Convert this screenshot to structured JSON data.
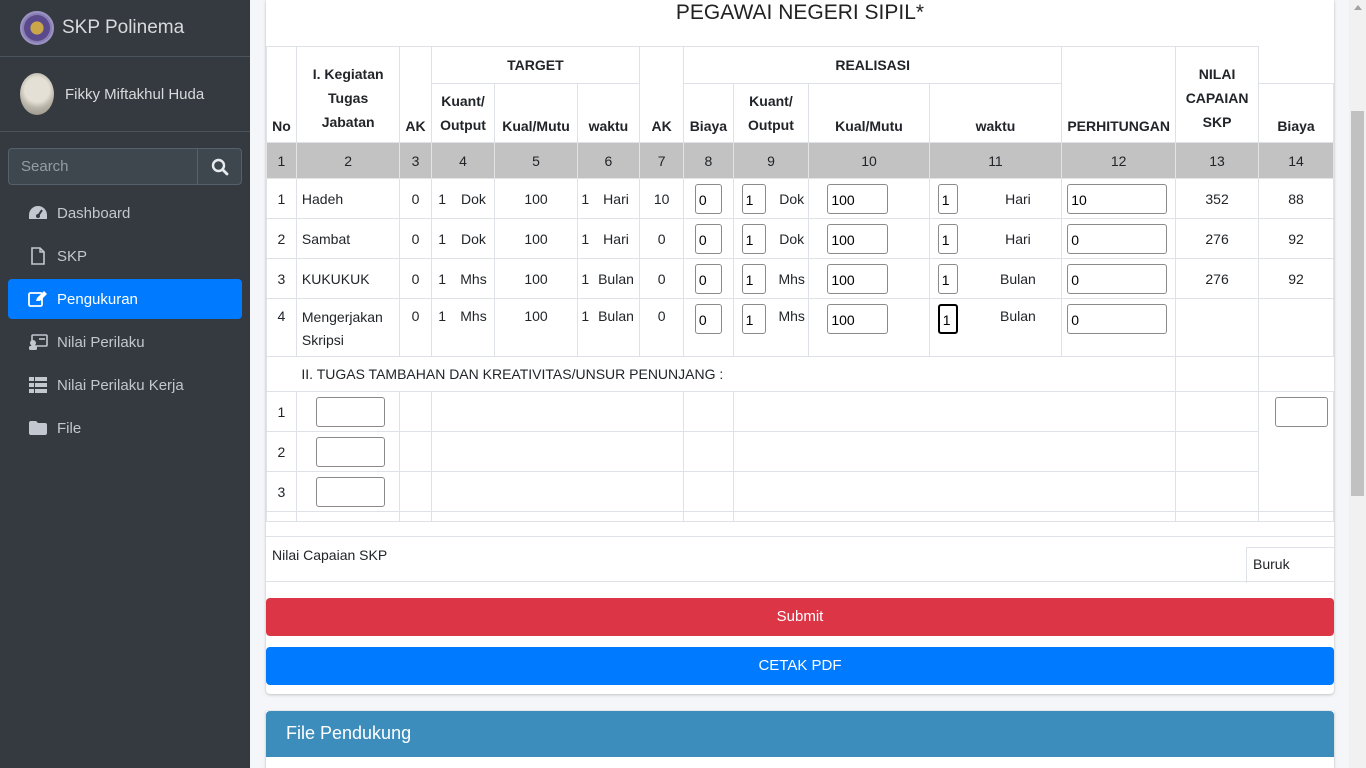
{
  "app": {
    "brand": "SKP Polinema"
  },
  "user": {
    "name": "Fikky Miftakhul Huda"
  },
  "search": {
    "placeholder": "Search"
  },
  "nav": [
    {
      "label": "Dashboard",
      "icon": "tachometer-icon"
    },
    {
      "label": "SKP",
      "icon": "file-icon"
    },
    {
      "label": "Pengukuran",
      "icon": "edit-icon",
      "active": true
    },
    {
      "label": "Nilai Perilaku",
      "icon": "id-card-icon"
    },
    {
      "label": "Nilai Perilaku Kerja",
      "icon": "list-icon"
    },
    {
      "label": "File",
      "icon": "folder-icon"
    }
  ],
  "page": {
    "title": "PEGAWAI NEGERI SIPIL*"
  },
  "table": {
    "headers": {
      "no": "No",
      "kegiatan": "I. Kegiatan Tugas Jabatan",
      "ak": "AK",
      "target": "TARGET",
      "realisasi": "REALISASI",
      "kuant_output": "Kuant/ Output",
      "kual_mutu": "Kual/Mutu",
      "waktu": "waktu",
      "biaya": "Biaya",
      "perhitungan": "PERHITUNGAN",
      "nilai_capaian": "NILAI CAPAIAN SKP"
    },
    "column_numbers": [
      "1",
      "2",
      "3",
      "4",
      "5",
      "6",
      "7",
      "8",
      "9",
      "10",
      "11",
      "12",
      "13",
      "14"
    ],
    "rows": [
      {
        "no": "1",
        "kegiatan": "Hadeh",
        "ak": "0",
        "t_kuant": "1",
        "t_unit": "Dok",
        "t_kual": "100",
        "t_waktu": "1",
        "t_waktu_unit": "Hari",
        "t_biaya": "10",
        "r_ak": "0",
        "r_kuant": "1",
        "r_unit": "Dok",
        "r_kual": "100",
        "r_waktu": "1",
        "r_waktu_unit": "Hari",
        "r_biaya": "10",
        "perhitungan": "352",
        "nilai": "88"
      },
      {
        "no": "2",
        "kegiatan": "Sambat",
        "ak": "0",
        "t_kuant": "1",
        "t_unit": "Dok",
        "t_kual": "100",
        "t_waktu": "1",
        "t_waktu_unit": "Hari",
        "t_biaya": "0",
        "r_ak": "0",
        "r_kuant": "1",
        "r_unit": "Dok",
        "r_kual": "100",
        "r_waktu": "1",
        "r_waktu_unit": "Hari",
        "r_biaya": "0",
        "perhitungan": "276",
        "nilai": "92"
      },
      {
        "no": "3",
        "kegiatan": "KUKUKUK",
        "ak": "0",
        "t_kuant": "1",
        "t_unit": "Mhs",
        "t_kual": "100",
        "t_waktu": "1",
        "t_waktu_unit": "Bulan",
        "t_biaya": "0",
        "r_ak": "0",
        "r_kuant": "1",
        "r_unit": "Mhs",
        "r_kual": "100",
        "r_waktu": "1",
        "r_waktu_unit": "Bulan",
        "r_biaya": "0",
        "perhitungan": "276",
        "nilai": "92"
      },
      {
        "no": "4",
        "kegiatan": "Mengerjakan Skripsi",
        "ak": "0",
        "t_kuant": "1",
        "t_unit": "Mhs",
        "t_kual": "100",
        "t_waktu": "1",
        "t_waktu_unit": "Bulan",
        "t_biaya": "0",
        "r_ak": "0",
        "r_kuant": "1",
        "r_unit": "Mhs",
        "r_kual": "100",
        "r_waktu": "1",
        "r_waktu_unit": "Bulan",
        "r_biaya": "0",
        "perhitungan": "",
        "nilai": ""
      }
    ],
    "section2_title": "II. TUGAS TAMBAHAN DAN KREATIVITAS/UNSUR PENUNJANG :",
    "section2_rows": [
      "1",
      "2",
      "3"
    ]
  },
  "capaian": {
    "label": "Nilai Capaian SKP",
    "value": "Buruk"
  },
  "buttons": {
    "submit": "Submit",
    "pdf": "CETAK PDF"
  },
  "card2": {
    "title": "File Pendukung"
  },
  "colors": {
    "sidebar": "#343a40",
    "active": "#007bff",
    "submit": "#dc3545",
    "pdf": "#007bff",
    "card_header": "#3c8dbc"
  }
}
